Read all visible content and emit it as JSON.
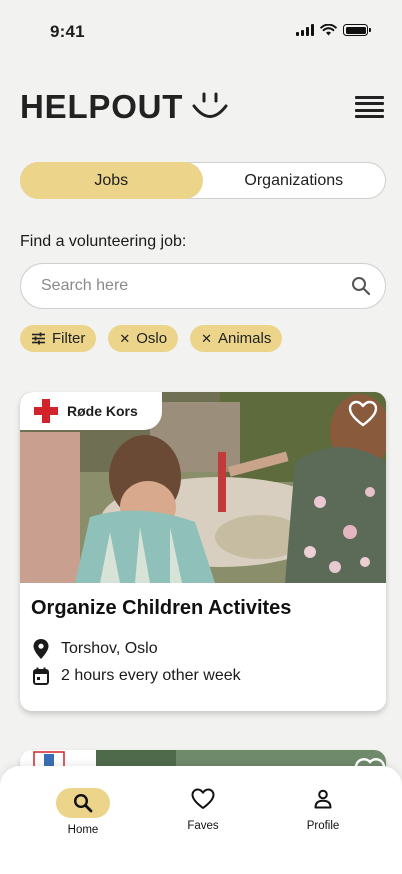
{
  "status_bar": {
    "time": "9:41"
  },
  "header": {
    "logo_text": "HELPOUT"
  },
  "segments": [
    {
      "label": "Jobs",
      "active": true
    },
    {
      "label": "Organizations",
      "active": false
    }
  ],
  "find_label": "Find a volunteering job:",
  "search": {
    "placeholder": "Search here",
    "value": ""
  },
  "chips": [
    {
      "label": "Filter",
      "icon": "sliders-icon"
    },
    {
      "label": "Oslo",
      "icon": "close-icon"
    },
    {
      "label": "Animals",
      "icon": "close-icon"
    }
  ],
  "job_card": {
    "organization": "Røde Kors",
    "title": "Organize Children Activites",
    "location": "Torshov, Oslo",
    "schedule": "2 hours every other week"
  },
  "bottom_nav": [
    {
      "label": "Home",
      "icon": "search-icon",
      "active": true
    },
    {
      "label": "Faves",
      "icon": "heart-icon",
      "active": false
    },
    {
      "label": "Profile",
      "icon": "person-icon",
      "active": false
    }
  ],
  "colors": {
    "accent": "#ecd58a",
    "background": "#f2f2f0",
    "red_cross": "#d2232a"
  }
}
